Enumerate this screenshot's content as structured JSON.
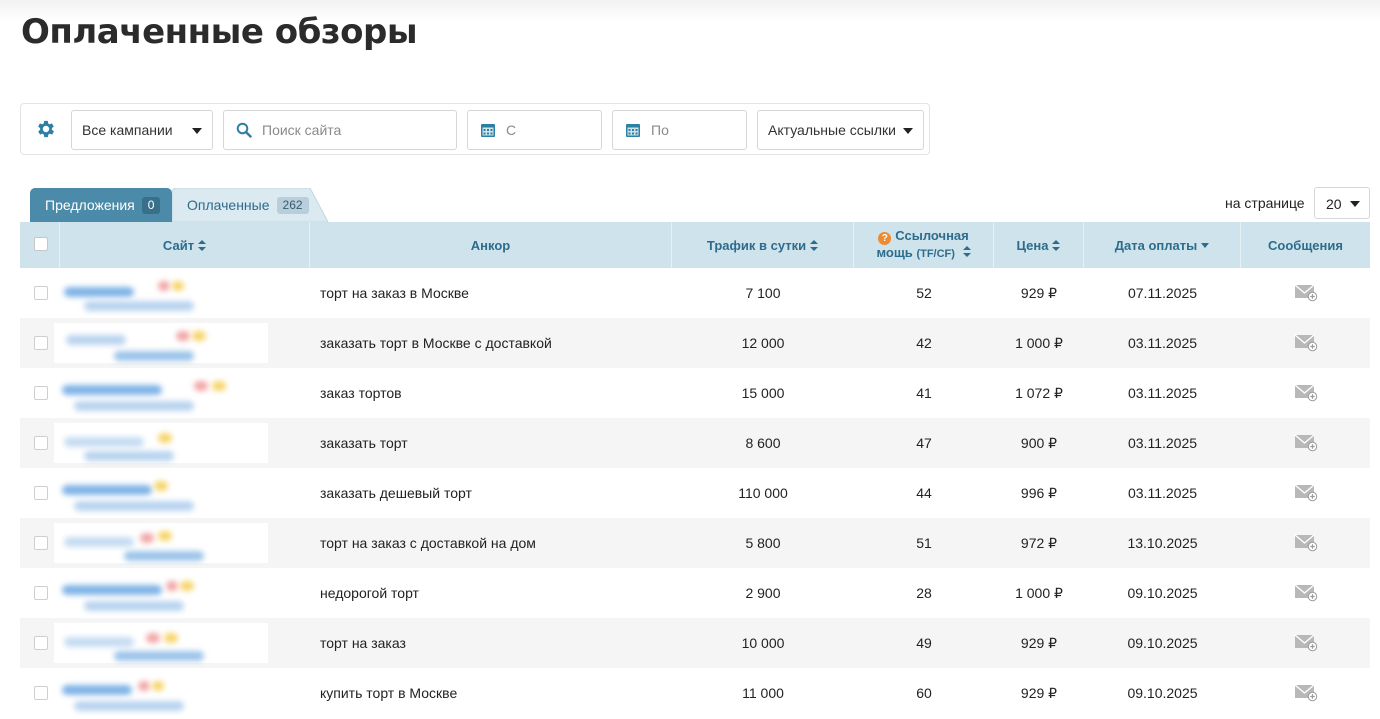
{
  "page": {
    "title": "Оплаченные обзоры"
  },
  "filters": {
    "campaign": "Все кампании",
    "search_placeholder": "Поиск сайта",
    "date_from_placeholder": "С",
    "date_to_placeholder": "По",
    "links_filter": "Актуальные ссылки"
  },
  "tabs": [
    {
      "label": "Предложения",
      "count": "0"
    },
    {
      "label": "Оплаченные",
      "count": "262"
    }
  ],
  "pagination": {
    "per_page_label": "на странице",
    "per_page_value": "20"
  },
  "table": {
    "columns": {
      "site": "Сайт",
      "anchor": "Анкор",
      "traffic": "Трафик в сутки",
      "power_line1": "Ссылочная",
      "power_line2": "мощь",
      "power_unit": "(TF/CF)",
      "price": "Цена",
      "paid_date": "Дата оплаты",
      "messages": "Сообщения"
    },
    "rows": [
      {
        "anchor": "торт на заказ в Москве",
        "traffic": "7 100",
        "power": "52",
        "price": "929 ₽",
        "date": "07.11.2025"
      },
      {
        "anchor": "заказать торт в Москве с доставкой",
        "traffic": "12 000",
        "power": "42",
        "price": "1 000 ₽",
        "date": "03.11.2025"
      },
      {
        "anchor": "заказ тортов",
        "traffic": "15 000",
        "power": "41",
        "price": "1 072 ₽",
        "date": "03.11.2025"
      },
      {
        "anchor": "заказать торт",
        "traffic": "8 600",
        "power": "47",
        "price": "900 ₽",
        "date": "03.11.2025"
      },
      {
        "anchor": "заказать дешевый торт",
        "traffic": "110 000",
        "power": "44",
        "price": "996 ₽",
        "date": "03.11.2025"
      },
      {
        "anchor": "торт на заказ с доставкой на дом",
        "traffic": "5 800",
        "power": "51",
        "price": "972 ₽",
        "date": "13.10.2025"
      },
      {
        "anchor": "недорогой торт",
        "traffic": "2 900",
        "power": "28",
        "price": "1 000 ₽",
        "date": "09.10.2025"
      },
      {
        "anchor": "торт на заказ",
        "traffic": "10 000",
        "power": "49",
        "price": "929 ₽",
        "date": "09.10.2025"
      },
      {
        "anchor": "купить торт в Москве",
        "traffic": "11 000",
        "power": "60",
        "price": "929 ₽",
        "date": "09.10.2025"
      }
    ]
  },
  "colors": {
    "accent": "#4b8aa8",
    "header_bg": "#cfe3ec",
    "header_text": "#2d6c8c"
  }
}
